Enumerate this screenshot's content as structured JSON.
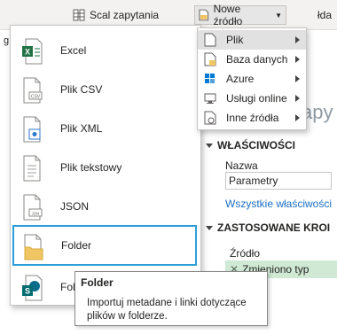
{
  "ribbon": {
    "merge_queries": "Scal zapytania",
    "new_source": "Nowe źródło",
    "right_fragment": "łda",
    "left_fragment": "g"
  },
  "menu": {
    "items": [
      {
        "label": "Excel",
        "icon": "excel-icon"
      },
      {
        "label": "Plik CSV",
        "icon": "csv-file-icon"
      },
      {
        "label": "Plik XML",
        "icon": "xml-file-icon"
      },
      {
        "label": "Plik tekstowy",
        "icon": "text-file-icon"
      },
      {
        "label": "JSON",
        "icon": "json-file-icon"
      },
      {
        "label": "Folder",
        "icon": "folder-icon"
      },
      {
        "label": "Fol",
        "icon": "sharepoint-folder-icon"
      }
    ]
  },
  "submenu": {
    "items": [
      {
        "label": "Plik",
        "icon": "file-icon"
      },
      {
        "label": "Baza danych",
        "icon": "database-icon"
      },
      {
        "label": "Azure",
        "icon": "azure-icon"
      },
      {
        "label": "Usługi online",
        "icon": "online-services-icon"
      },
      {
        "label": "Inne źródła",
        "icon": "other-sources-icon"
      }
    ]
  },
  "tooltip": {
    "title": "Folder",
    "body": "Importuj metadane i linki dotyczące plików w folderze."
  },
  "panel": {
    "title_fragment": "apy",
    "properties_heading": "WŁAŚCIWOŚCI",
    "name_label": "Nazwa",
    "name_value": "Parametry",
    "all_properties_link": "Wszystkie właściwości",
    "applied_steps_heading": "ZASTOSOWANE KROI",
    "steps": [
      "Źródło",
      "Zmieniono typ"
    ]
  },
  "colors": {
    "selection_border": "#2d9ed8",
    "excel_green": "#217346",
    "folder_yellow": "#f0c665",
    "link_blue": "#1b6ec2",
    "step_selected": "#cfe9d4"
  }
}
